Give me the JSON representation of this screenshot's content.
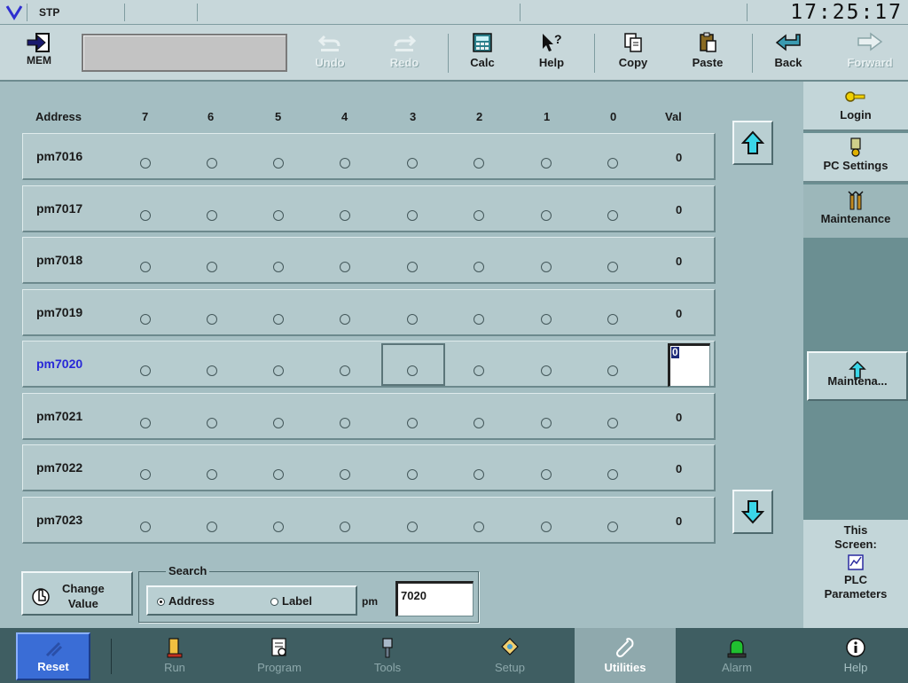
{
  "status": {
    "mode": "STP",
    "clock": "17:25:17"
  },
  "toolbar": {
    "mem_label": "MEM",
    "mem_field_value": "",
    "undo_label": "Undo",
    "redo_label": "Redo",
    "calc_label": "Calc",
    "help_label": "Help",
    "copy_label": "Copy",
    "paste_label": "Paste",
    "back_label": "Back",
    "forward_label": "Forward"
  },
  "table": {
    "headers": [
      "Address",
      "7",
      "6",
      "5",
      "4",
      "3",
      "2",
      "1",
      "0",
      "Val"
    ],
    "rows": [
      {
        "address": "pm7016",
        "bits": [
          0,
          0,
          0,
          0,
          0,
          0,
          0,
          0
        ],
        "value": "0"
      },
      {
        "address": "pm7017",
        "bits": [
          0,
          0,
          0,
          0,
          0,
          0,
          0,
          0
        ],
        "value": "0"
      },
      {
        "address": "pm7018",
        "bits": [
          0,
          0,
          0,
          0,
          0,
          0,
          0,
          0
        ],
        "value": "0"
      },
      {
        "address": "pm7019",
        "bits": [
          0,
          0,
          0,
          0,
          0,
          0,
          0,
          0
        ],
        "value": "0"
      },
      {
        "address": "pm7020",
        "bits": [
          0,
          0,
          0,
          0,
          0,
          0,
          0,
          0
        ],
        "value": "0",
        "active": true
      },
      {
        "address": "pm7021",
        "bits": [
          0,
          0,
          0,
          0,
          0,
          0,
          0,
          0
        ],
        "value": "0"
      },
      {
        "address": "pm7022",
        "bits": [
          0,
          0,
          0,
          0,
          0,
          0,
          0,
          0
        ],
        "value": "0"
      },
      {
        "address": "pm7023",
        "bits": [
          0,
          0,
          0,
          0,
          0,
          0,
          0,
          0
        ],
        "value": "0"
      }
    ]
  },
  "controls": {
    "change_value_label": "Change Value",
    "change_line1": "Change",
    "change_line2": "Value",
    "search_legend": "Search",
    "radio_address": "Address",
    "radio_label": "Label",
    "selected_radio": "Address",
    "search_prefix": "pm",
    "search_value": "7020"
  },
  "sidebar": {
    "login": "Login",
    "pc_settings": "PC Settings",
    "maintenance": "Maintenance",
    "maintena_btn": "Maintena...",
    "this_screen_line1": "This",
    "this_screen_line2": "Screen:",
    "this_screen_line3": "PLC",
    "this_screen_line4": "Parameters"
  },
  "nav": {
    "reset": "Reset",
    "run": "Run",
    "program": "Program",
    "tools": "Tools",
    "setup": "Setup",
    "utilities": "Utilities",
    "alarm": "Alarm",
    "help": "Help",
    "active": "Utilities"
  },
  "colors": {
    "background": "#9fb9bd",
    "active_address": "#2828d8",
    "arrow": "#3ad6e8",
    "reset_button": "#3a6dd6",
    "active_nav": "#8fa9ad"
  },
  "icons": {
    "mem": "mem-arrow-icon",
    "undo": "undo-icon",
    "redo": "redo-icon",
    "calc": "calculator-icon",
    "help": "help-pointer-icon",
    "copy": "copy-icon",
    "paste": "paste-icon",
    "back": "back-arrow-icon",
    "forward": "forward-arrow-icon",
    "login": "key-icon",
    "pc_settings": "pc-settings-icon",
    "maintenance": "maintenance-icon",
    "scroll_up": "arrow-up-icon",
    "scroll_down": "arrow-down-icon",
    "change_value": "hand-icon"
  }
}
